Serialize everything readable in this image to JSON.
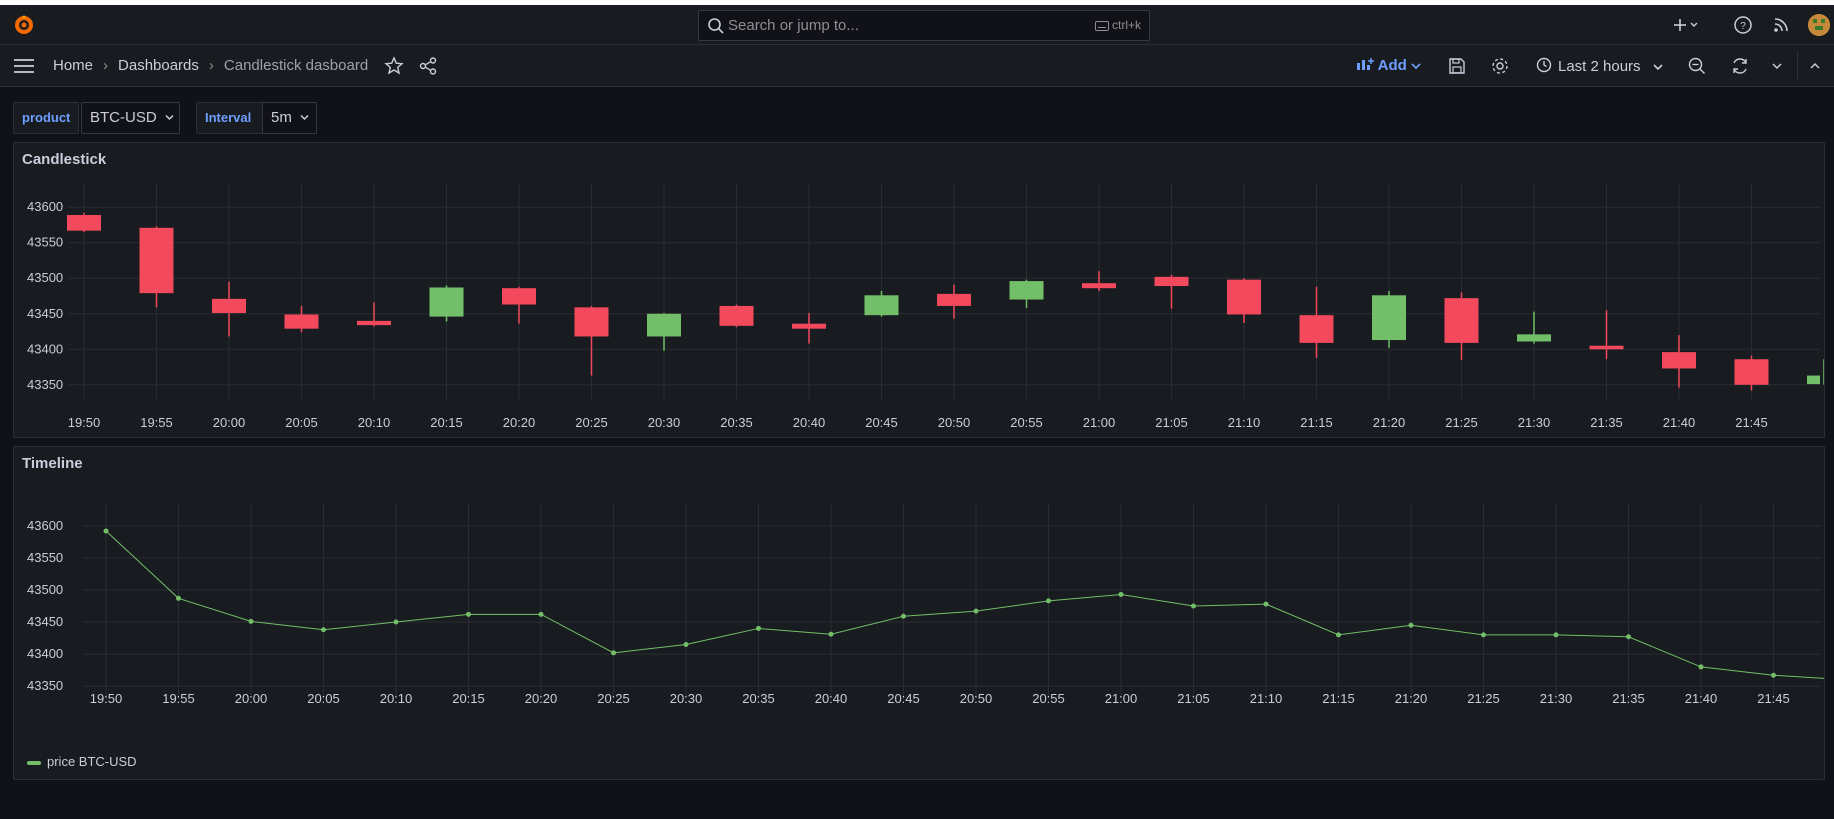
{
  "topnav": {
    "search_placeholder": "Search or jump to...",
    "search_shortcut": "ctrl+k",
    "icons": [
      "grafana-logo-icon",
      "search-icon",
      "keyboard-icon",
      "plus-icon",
      "chevron-down-icon",
      "help-icon",
      "rss-icon",
      "user-avatar"
    ]
  },
  "subnav": {
    "breadcrumbs": [
      "Home",
      "Dashboards",
      "Candlestick dasboard"
    ],
    "add_label": "Add",
    "time_range_label": "Last 2 hours"
  },
  "variables": {
    "product_label": "product",
    "product_value": "BTC-USD",
    "interval_label": "Interval",
    "interval_value": "5m"
  },
  "colors": {
    "up": "#73bf69",
    "down": "#f2495c",
    "line": "#73bf69",
    "accent": "#6e9fff"
  },
  "panels": {
    "candlestick_title": "Candlestick",
    "timeline_title": "Timeline",
    "legend_label": "price BTC-USD"
  },
  "chart_data": [
    {
      "type": "candlestick",
      "title": "Candlestick",
      "ylim": [
        43330,
        43620
      ],
      "y_ticks": [
        43350,
        43400,
        43450,
        43500,
        43550,
        43600
      ],
      "x_ticks": [
        "19:50",
        "19:55",
        "20:00",
        "20:05",
        "20:10",
        "20:15",
        "20:20",
        "20:25",
        "20:30",
        "20:35",
        "20:40",
        "20:45",
        "20:50",
        "20:55",
        "21:00",
        "21:05",
        "21:10",
        "21:15",
        "21:20",
        "21:25",
        "21:30",
        "21:35",
        "21:40",
        "21:45"
      ],
      "x": [
        "19:50",
        "19:55",
        "20:00",
        "20:05",
        "20:10",
        "20:15",
        "20:20",
        "20:25",
        "20:30",
        "20:35",
        "20:40",
        "20:45",
        "20:50",
        "20:55",
        "21:00",
        "21:05",
        "21:10",
        "21:15",
        "21:20",
        "21:25",
        "21:30",
        "21:35",
        "21:40",
        "21:45",
        "21:50"
      ],
      "open": [
        43589,
        43571,
        43471,
        43449,
        43440,
        43446,
        43486,
        43459,
        43418,
        43461,
        43436,
        43448,
        43478,
        43470,
        43493,
        43502,
        43498,
        43448,
        43413,
        43472,
        43411,
        43405,
        43396,
        43386,
        43351
      ],
      "close": [
        43567,
        43479,
        43451,
        43429,
        43434,
        43487,
        43463,
        43418,
        43450,
        43433,
        43429,
        43476,
        43461,
        43496,
        43486,
        43489,
        43449,
        43409,
        43476,
        43409,
        43421,
        43400,
        43373,
        43350,
        43363
      ],
      "high": [
        43592,
        43573,
        43495,
        43461,
        43466,
        43490,
        43488,
        43461,
        43451,
        43463,
        43451,
        43482,
        43491,
        43498,
        43510,
        43505,
        43500,
        43488,
        43482,
        43480,
        43453,
        43455,
        43420,
        43391,
        43386
      ],
      "low": [
        43565,
        43459,
        43418,
        43424,
        43432,
        43439,
        43436,
        43363,
        43398,
        43431,
        43408,
        43446,
        43443,
        43458,
        43482,
        43457,
        43437,
        43388,
        43402,
        43385,
        43408,
        43386,
        43346,
        43342,
        43350
      ]
    },
    {
      "type": "line",
      "title": "Timeline",
      "ylim": [
        43330,
        43620
      ],
      "y_ticks": [
        43350,
        43400,
        43450,
        43500,
        43550,
        43600
      ],
      "x_ticks": [
        "19:50",
        "19:55",
        "20:00",
        "20:05",
        "20:10",
        "20:15",
        "20:20",
        "20:25",
        "20:30",
        "20:35",
        "20:40",
        "20:45",
        "20:50",
        "20:55",
        "21:00",
        "21:05",
        "21:10",
        "21:15",
        "21:20",
        "21:25",
        "21:30",
        "21:35",
        "21:40",
        "21:45"
      ],
      "series": [
        {
          "name": "price BTC-USD",
          "x": [
            "19:50",
            "19:55",
            "20:00",
            "20:05",
            "20:10",
            "20:15",
            "20:20",
            "20:25",
            "20:30",
            "20:35",
            "20:40",
            "20:45",
            "20:50",
            "20:55",
            "21:00",
            "21:05",
            "21:10",
            "21:15",
            "21:20",
            "21:25",
            "21:30",
            "21:35",
            "21:40",
            "21:45",
            "21:50"
          ],
          "values": [
            43592,
            43487,
            43451,
            43438,
            43450,
            43462,
            43462,
            43402,
            43415,
            43440,
            43431,
            43459,
            43467,
            43483,
            43493,
            43475,
            43478,
            43430,
            43445,
            43430,
            43430,
            43427,
            43380,
            43367,
            43360
          ]
        }
      ]
    }
  ]
}
